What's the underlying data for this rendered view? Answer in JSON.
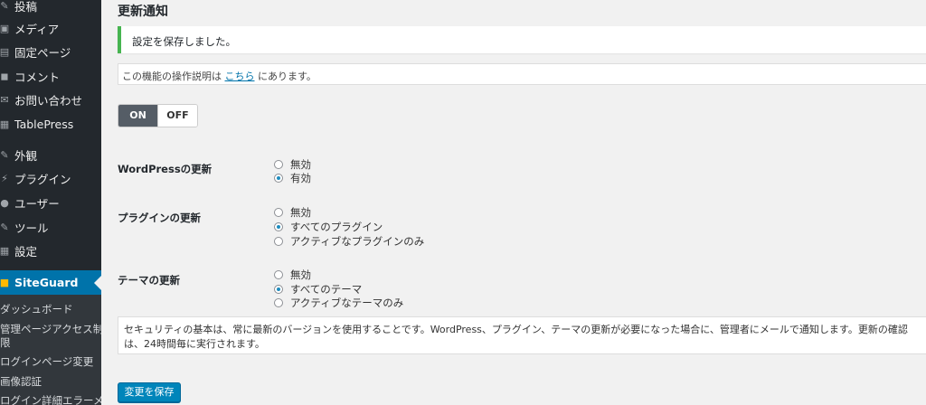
{
  "sidebar": {
    "items": [
      {
        "label": "投稿",
        "icon": "pin-icon",
        "glyph": "✎"
      },
      {
        "label": "メディア",
        "icon": "media-icon",
        "glyph": "▣"
      },
      {
        "label": "固定ページ",
        "icon": "page-icon",
        "glyph": "▤"
      },
      {
        "label": "コメント",
        "icon": "comment-icon",
        "glyph": "◼"
      },
      {
        "label": "お問い合わせ",
        "icon": "mail-icon",
        "glyph": "✉"
      },
      {
        "label": "TablePress",
        "icon": "table-icon",
        "glyph": "▦"
      },
      {
        "label": "外観",
        "icon": "brush-icon",
        "glyph": "✎"
      },
      {
        "label": "プラグイン",
        "icon": "plugin-icon",
        "glyph": "⚡"
      },
      {
        "label": "ユーザー",
        "icon": "user-icon",
        "glyph": "●"
      },
      {
        "label": "ツール",
        "icon": "wrench-icon",
        "glyph": "✎"
      },
      {
        "label": "設定",
        "icon": "settings-icon",
        "glyph": "▦"
      },
      {
        "label": "SiteGuard",
        "icon": "siteguard-icon",
        "glyph": "■"
      }
    ],
    "submenu": [
      "ダッシュボード",
      "管理ページアクセス制",
      "限",
      "ログインページ変更",
      "画像認証",
      "ログイン詳細エラーメ"
    ]
  },
  "main": {
    "title": "更新通知",
    "notice": "設定を保存しました。",
    "help_prefix": "この機能の操作説明は",
    "help_link": "こちら",
    "help_suffix": "にあります。",
    "toggle_on": "ON",
    "toggle_off": "OFF",
    "sections": [
      {
        "label": "WordPressの更新",
        "options": [
          "無効",
          "有効"
        ],
        "selected": 1
      },
      {
        "label": "プラグインの更新",
        "options": [
          "無効",
          "すべてのプラグイン",
          "アクティブなプラグインのみ"
        ],
        "selected": 1
      },
      {
        "label": "テーマの更新",
        "options": [
          "無効",
          "すべてのテーマ",
          "アクティブなテーマのみ"
        ],
        "selected": 1
      }
    ],
    "description": "セキュリティの基本は、常に最新のバージョンを使用することです。WordPress、プラグイン、テーマの更新が必要になった場合に、管理者にメールで通知します。更新の確認は、24時間毎に実行されます。",
    "save_label": "変更を保存"
  },
  "colors": {
    "sidebar_bg": "#23282d",
    "active": "#0073aa",
    "notice_border": "#46b450",
    "button": "#0085ba"
  }
}
